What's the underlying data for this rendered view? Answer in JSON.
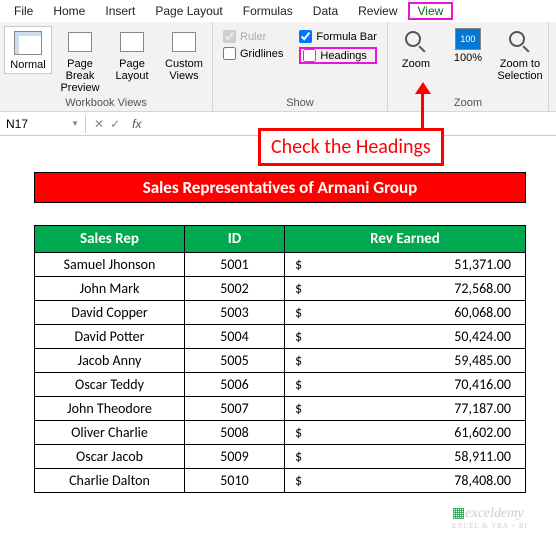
{
  "tabs": [
    "File",
    "Home",
    "Insert",
    "Page Layout",
    "Formulas",
    "Data",
    "Review",
    "View"
  ],
  "active_tab": "View",
  "ribbon": {
    "workbook_views": {
      "label": "Workbook Views",
      "buttons": [
        "Normal",
        "Page Break Preview",
        "Page Layout",
        "Custom Views"
      ]
    },
    "show": {
      "label": "Show",
      "ruler": "Ruler",
      "gridlines": "Gridlines",
      "formula_bar": "Formula Bar",
      "headings": "Headings"
    },
    "zoom": {
      "label": "Zoom",
      "zoom": "Zoom",
      "hundred": "100%",
      "selection": "Zoom to Selection"
    }
  },
  "name_box": "N17",
  "fx": "fx",
  "annotation": "Check the Headings",
  "sheet": {
    "title": "Sales Representatives of Armani Group",
    "headers": [
      "Sales Rep",
      "ID",
      "Rev Earned"
    ],
    "rows": [
      {
        "rep": "Samuel Jhonson",
        "id": "5001",
        "rev": "51,371.00"
      },
      {
        "rep": "John Mark",
        "id": "5002",
        "rev": "72,568.00"
      },
      {
        "rep": "David Copper",
        "id": "5003",
        "rev": "60,068.00"
      },
      {
        "rep": "David Potter",
        "id": "5004",
        "rev": "50,424.00"
      },
      {
        "rep": "Jacob Anny",
        "id": "5005",
        "rev": "59,485.00"
      },
      {
        "rep": "Oscar Teddy",
        "id": "5006",
        "rev": "70,416.00"
      },
      {
        "rep": "John Theodore",
        "id": "5007",
        "rev": "77,187.00"
      },
      {
        "rep": "Oliver Charlie",
        "id": "5008",
        "rev": "61,602.00"
      },
      {
        "rep": "Oscar Jacob",
        "id": "5009",
        "rev": "58,911.00"
      },
      {
        "rep": "Charlie Dalton",
        "id": "5010",
        "rev": "78,408.00"
      }
    ]
  },
  "currency": "$",
  "watermark": "exceldemy",
  "watermark_sub": "EXCEL & VBA + BI"
}
